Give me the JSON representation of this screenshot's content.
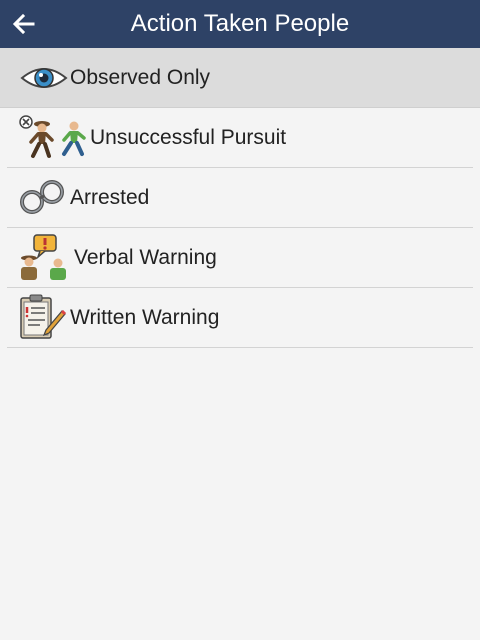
{
  "header": {
    "title": "Action Taken People",
    "back_icon": "arrow-left-icon",
    "background": "#2e4266"
  },
  "list": {
    "items": [
      {
        "label": "Observed Only",
        "icon": "eye-icon",
        "selected": true
      },
      {
        "label": "Unsuccessful Pursuit",
        "icon": "pursuit-icon",
        "selected": false
      },
      {
        "label": "Arrested",
        "icon": "handcuffs-icon",
        "selected": false
      },
      {
        "label": "Verbal Warning",
        "icon": "verbal-warning-icon",
        "selected": false
      },
      {
        "label": "Written Warning",
        "icon": "written-warning-icon",
        "selected": false
      }
    ]
  },
  "colors": {
    "selected_row": "#dcdcdc",
    "page_background": "#f4f4f4"
  }
}
